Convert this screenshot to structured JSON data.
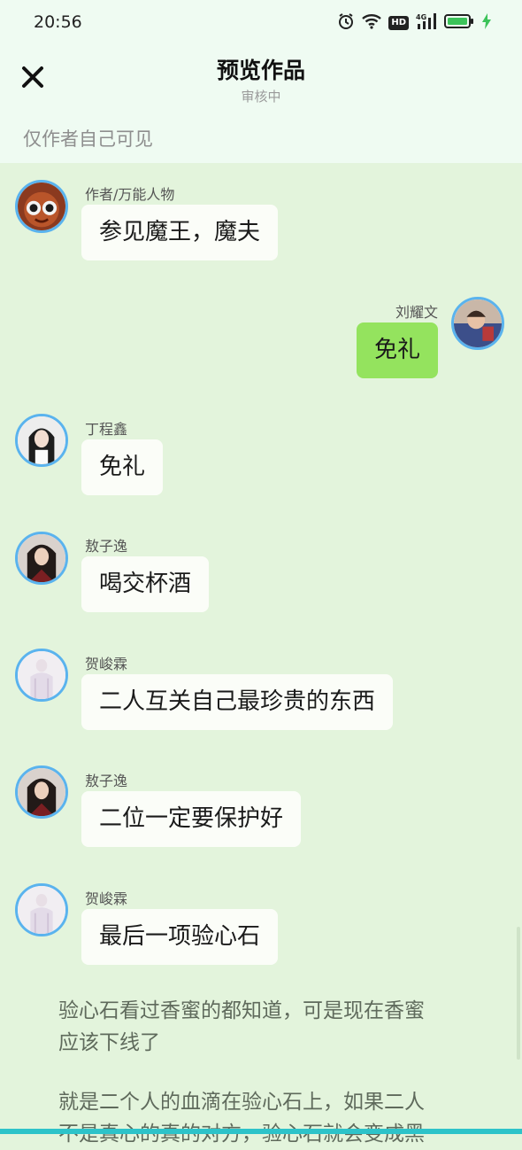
{
  "status_bar": {
    "time": "20:56",
    "icons": [
      "alarm-icon",
      "wifi-icon",
      "hd-icon",
      "signal-4g-icon",
      "battery-icon",
      "charging-icon"
    ],
    "hd_label": "HD",
    "network_label": "4G"
  },
  "header": {
    "title": "预览作品",
    "subtitle": "审核中",
    "close_icon": "close-icon",
    "privacy_note": "仅作者自己可见"
  },
  "messages": [
    {
      "sender": "作者/万能人物",
      "text": "参见魔王，魔夫",
      "side": "left"
    },
    {
      "sender": "刘耀文",
      "text": "免礼",
      "side": "right"
    },
    {
      "sender": "丁程鑫",
      "text": "免礼",
      "side": "left"
    },
    {
      "sender": "敖子逸",
      "text": "喝交杯酒",
      "side": "left"
    },
    {
      "sender": "贺峻霖",
      "text": "二人互关自己最珍贵的东西",
      "side": "left"
    },
    {
      "sender": "敖子逸",
      "text": "二位一定要保护好",
      "side": "left"
    },
    {
      "sender": "贺峻霖",
      "text": "最后一项验心石",
      "side": "left"
    }
  ],
  "narration": [
    "验心石看过香蜜的都知道，可是现在香蜜",
    "应该下线了",
    "就是二个人的血滴在验心石上，如果二人",
    "不是真心的真的对方，验心石就会变成黑"
  ],
  "colors": {
    "background": "#e3f4dc",
    "header_background": "#effbf2",
    "bubble": "#fbfdf8",
    "my_bubble": "#94e35e",
    "avatar_ring": "#5ab3ee",
    "bottom_bar": "#2dc3c9"
  }
}
